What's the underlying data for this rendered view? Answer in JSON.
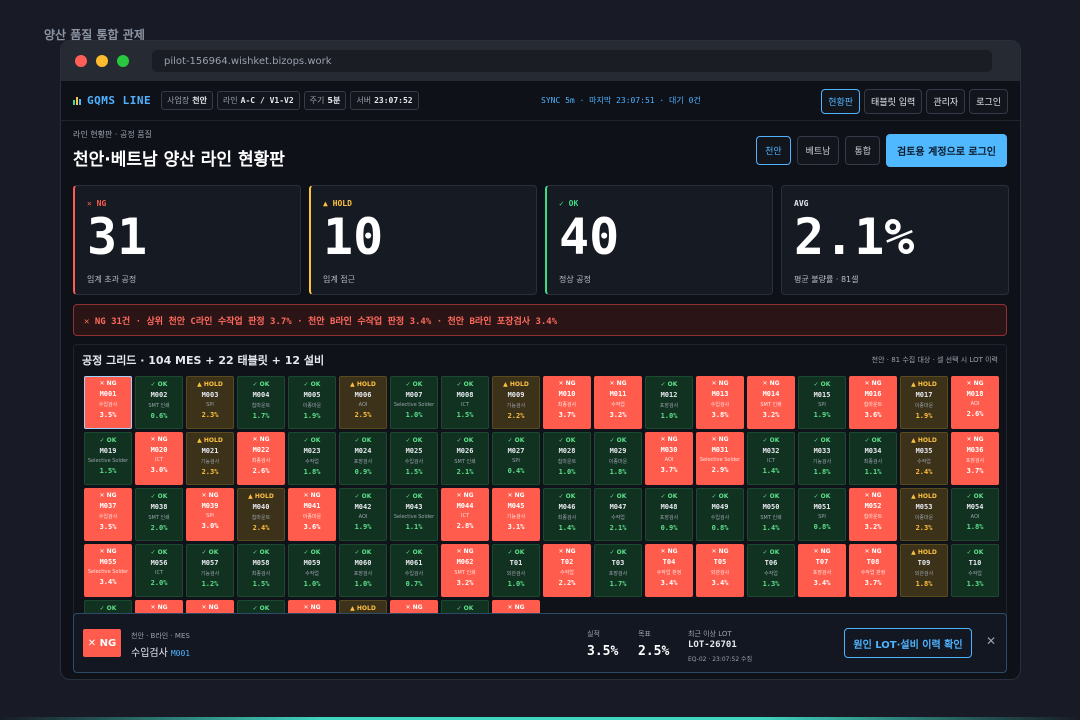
{
  "page_caption": "양산 품질 통합 관제",
  "browser": {
    "url": "pilot-156964.wishket.bizops.work"
  },
  "appbar": {
    "brand": "GQMS LINE",
    "chips": [
      {
        "label": "사업장",
        "value": "천안"
      },
      {
        "label": "라인",
        "value": "A-C / V1-V2"
      },
      {
        "label": "주기",
        "value": "5분"
      },
      {
        "label": "서버",
        "value": "23:07:52"
      }
    ],
    "sync_text": "SYNC 5m · 마지막 23:07:51 · 대기 0건",
    "nav": [
      "현황판",
      "태블릿 입력",
      "관리자",
      "로그인"
    ]
  },
  "header": {
    "breadcrumb": "라인 현황판 · 공정 품질",
    "title": "천안·베트남 양산 라인 현황판",
    "sites": [
      "천안",
      "베트남",
      "통합"
    ],
    "login_cta": "검토용 계정으로 로그인"
  },
  "cards": [
    {
      "tag": "✕ NG",
      "value": "31",
      "sub": "임계 초과 공정",
      "color": "#ff5c4d"
    },
    {
      "tag": "▲ HOLD",
      "value": "10",
      "sub": "임계 접근",
      "color": "#ffc23d"
    },
    {
      "tag": "✓ OK",
      "value": "40",
      "sub": "정상 공정",
      "color": "#3ddc84"
    },
    {
      "tag": "AVG",
      "value": "2.1%",
      "sub": "평균 불량률 · 81셀",
      "color": "#e6e9ef"
    }
  ],
  "alert": "✕ NG 31건 · 상위 천안 C라인 수작업 판정 3.7% · 천안 B라인 수작업 판정 3.4% · 천안 B라인 포장검사 3.4%",
  "grid": {
    "title": "공정 그리드 · 104 MES + 22 태블릿 + 12 설비",
    "meta": "천안 · 81 수집 대상 · 셀 선택 시 LOT 이력",
    "status_labels": {
      "ng": "✕ NG",
      "ok": "✓ OK",
      "hold": "▲ HOLD"
    },
    "cells": [
      {
        "id": "M001",
        "s": "ng",
        "p": "수입검사",
        "v": "3.5%"
      },
      {
        "id": "M002",
        "s": "ok",
        "p": "SMT 인쇄",
        "v": "0.6%"
      },
      {
        "id": "M003",
        "s": "hold",
        "p": "SPI",
        "v": "2.3%"
      },
      {
        "id": "M004",
        "s": "ok",
        "p": "칩마운트",
        "v": "1.7%"
      },
      {
        "id": "M005",
        "s": "ok",
        "p": "이종마운",
        "v": "1.9%"
      },
      {
        "id": "M006",
        "s": "hold",
        "p": "AOI",
        "v": "2.5%"
      },
      {
        "id": "M007",
        "s": "ok",
        "p": "Selective Solder",
        "v": "1.0%"
      },
      {
        "id": "M008",
        "s": "ok",
        "p": "ICT",
        "v": "1.5%"
      },
      {
        "id": "M009",
        "s": "hold",
        "p": "기능검사",
        "v": "2.2%"
      },
      {
        "id": "M010",
        "s": "ng",
        "p": "최종검사",
        "v": "3.7%"
      },
      {
        "id": "M011",
        "s": "ng",
        "p": "수작업",
        "v": "3.2%"
      },
      {
        "id": "M012",
        "s": "ok",
        "p": "포장검사",
        "v": "1.0%"
      },
      {
        "id": "M013",
        "s": "ng",
        "p": "수입검사",
        "v": "3.8%"
      },
      {
        "id": "M014",
        "s": "ng",
        "p": "SMT 인쇄",
        "v": "3.2%"
      },
      {
        "id": "M015",
        "s": "ok",
        "p": "SPI",
        "v": "1.9%"
      },
      {
        "id": "M016",
        "s": "ng",
        "p": "칩마운트",
        "v": "3.6%"
      },
      {
        "id": "M017",
        "s": "hold",
        "p": "이종마운",
        "v": "1.9%"
      },
      {
        "id": "M018",
        "s": "ng",
        "p": "AOI",
        "v": "2.6%"
      },
      {
        "id": "M019",
        "s": "ok",
        "p": "Selective Solder",
        "v": "1.5%"
      },
      {
        "id": "M020",
        "s": "ng",
        "p": "ICT",
        "v": "3.0%"
      },
      {
        "id": "M021",
        "s": "hold",
        "p": "기능검사",
        "v": "2.3%"
      },
      {
        "id": "M022",
        "s": "ng",
        "p": "최종검사",
        "v": "2.6%"
      },
      {
        "id": "M023",
        "s": "ok",
        "p": "수작업",
        "v": "1.8%"
      },
      {
        "id": "M024",
        "s": "ok",
        "p": "포장검사",
        "v": "0.9%"
      },
      {
        "id": "M025",
        "s": "ok",
        "p": "수입검사",
        "v": "1.5%"
      },
      {
        "id": "M026",
        "s": "ok",
        "p": "SMT 인쇄",
        "v": "2.1%"
      },
      {
        "id": "M027",
        "s": "ok",
        "p": "SPI",
        "v": "0.4%"
      },
      {
        "id": "M028",
        "s": "ok",
        "p": "칩마운트",
        "v": "1.0%"
      },
      {
        "id": "M029",
        "s": "ok",
        "p": "이종마운",
        "v": "1.8%"
      },
      {
        "id": "M030",
        "s": "ng",
        "p": "AOI",
        "v": "3.7%"
      },
      {
        "id": "M031",
        "s": "ng",
        "p": "Selective Solder",
        "v": "2.9%"
      },
      {
        "id": "M032",
        "s": "ok",
        "p": "ICT",
        "v": "1.4%"
      },
      {
        "id": "M033",
        "s": "ok",
        "p": "기능검사",
        "v": "1.8%"
      },
      {
        "id": "M034",
        "s": "ok",
        "p": "최종검사",
        "v": "1.1%"
      },
      {
        "id": "M035",
        "s": "hold",
        "p": "수작업",
        "v": "2.4%"
      },
      {
        "id": "M036",
        "s": "ng",
        "p": "포장검사",
        "v": "3.7%"
      },
      {
        "id": "M037",
        "s": "ng",
        "p": "수입검사",
        "v": "3.5%"
      },
      {
        "id": "M038",
        "s": "ok",
        "p": "SMT 인쇄",
        "v": "2.0%"
      },
      {
        "id": "M039",
        "s": "ng",
        "p": "SPI",
        "v": "3.0%"
      },
      {
        "id": "M040",
        "s": "hold",
        "p": "칩마운트",
        "v": "2.4%"
      },
      {
        "id": "M041",
        "s": "ng",
        "p": "이종마운",
        "v": "3.6%"
      },
      {
        "id": "M042",
        "s": "ok",
        "p": "AOI",
        "v": "1.9%"
      },
      {
        "id": "M043",
        "s": "ok",
        "p": "Selective Solder",
        "v": "1.1%"
      },
      {
        "id": "M044",
        "s": "ng",
        "p": "ICT",
        "v": "2.8%"
      },
      {
        "id": "M045",
        "s": "ng",
        "p": "기능검사",
        "v": "3.1%"
      },
      {
        "id": "M046",
        "s": "ok",
        "p": "최종검사",
        "v": "1.4%"
      },
      {
        "id": "M047",
        "s": "ok",
        "p": "수작업",
        "v": "2.1%"
      },
      {
        "id": "M048",
        "s": "ok",
        "p": "포장검사",
        "v": "0.9%"
      },
      {
        "id": "M049",
        "s": "ok",
        "p": "수입검사",
        "v": "0.8%"
      },
      {
        "id": "M050",
        "s": "ok",
        "p": "SMT 인쇄",
        "v": "1.4%"
      },
      {
        "id": "M051",
        "s": "ok",
        "p": "SPI",
        "v": "0.8%"
      },
      {
        "id": "M052",
        "s": "ng",
        "p": "칩마운트",
        "v": "3.2%"
      },
      {
        "id": "M053",
        "s": "hold",
        "p": "이종마운",
        "v": "2.3%"
      },
      {
        "id": "M054",
        "s": "ok",
        "p": "AOI",
        "v": "1.8%"
      },
      {
        "id": "M055",
        "s": "ng",
        "p": "Selective Solder",
        "v": "3.4%"
      },
      {
        "id": "M056",
        "s": "ok",
        "p": "ICT",
        "v": "2.0%"
      },
      {
        "id": "M057",
        "s": "ok",
        "p": "기능검사",
        "v": "1.2%"
      },
      {
        "id": "M058",
        "s": "ok",
        "p": "최종검사",
        "v": "1.5%"
      },
      {
        "id": "M059",
        "s": "ok",
        "p": "수작업",
        "v": "1.0%"
      },
      {
        "id": "M060",
        "s": "ok",
        "p": "포장검사",
        "v": "1.0%"
      },
      {
        "id": "M061",
        "s": "ok",
        "p": "수입검사",
        "v": "0.7%"
      },
      {
        "id": "M062",
        "s": "ng",
        "p": "SMT 인쇄",
        "v": "3.2%"
      },
      {
        "id": "T01",
        "s": "ok",
        "p": "외관검사",
        "v": "1.0%"
      },
      {
        "id": "T02",
        "s": "ng",
        "p": "수작업",
        "v": "2.2%"
      },
      {
        "id": "T03",
        "s": "ok",
        "p": "포장검사",
        "v": "1.7%"
      },
      {
        "id": "T04",
        "s": "ng",
        "p": "수작업 판정",
        "v": "3.4%"
      },
      {
        "id": "T05",
        "s": "ng",
        "p": "외관검사",
        "v": "3.4%"
      },
      {
        "id": "T06",
        "s": "ok",
        "p": "수작업",
        "v": "1.3%"
      },
      {
        "id": "T07",
        "s": "ng",
        "p": "포장검사",
        "v": "3.4%"
      },
      {
        "id": "T08",
        "s": "ng",
        "p": "수작업 판정",
        "v": "3.7%"
      },
      {
        "id": "T09",
        "s": "hold",
        "p": "외관검사",
        "v": "1.8%"
      },
      {
        "id": "T10",
        "s": "ok",
        "p": "수작업",
        "v": "1.3%"
      },
      {
        "id": "",
        "s": "ok",
        "p": "",
        "v": ""
      },
      {
        "id": "",
        "s": "ng",
        "p": "",
        "v": ""
      },
      {
        "id": "",
        "s": "ng",
        "p": "",
        "v": ""
      },
      {
        "id": "",
        "s": "ok",
        "p": "",
        "v": ""
      },
      {
        "id": "",
        "s": "ng",
        "p": "",
        "v": ""
      },
      {
        "id": "",
        "s": "hold",
        "p": "",
        "v": ""
      },
      {
        "id": "",
        "s": "ng",
        "p": "",
        "v": ""
      },
      {
        "id": "",
        "s": "ok",
        "p": "",
        "v": ""
      },
      {
        "id": "",
        "s": "ng",
        "p": "",
        "v": ""
      }
    ]
  },
  "footer": {
    "badge": "✕ NG",
    "sub": "천안 · B라인 · MES",
    "process": "수입검사",
    "machine_id": "M001",
    "actual_label": "실적",
    "actual_value": "3.5%",
    "target_label": "목표",
    "target_value": "2.5%",
    "lot_label": "최근 이상 LOT",
    "lot_id": "LOT-26701",
    "lot_meta": "EQ-02 · 23:07:52 수집",
    "cta": "원인 LOT·설비 이력 확인",
    "close": "✕"
  }
}
